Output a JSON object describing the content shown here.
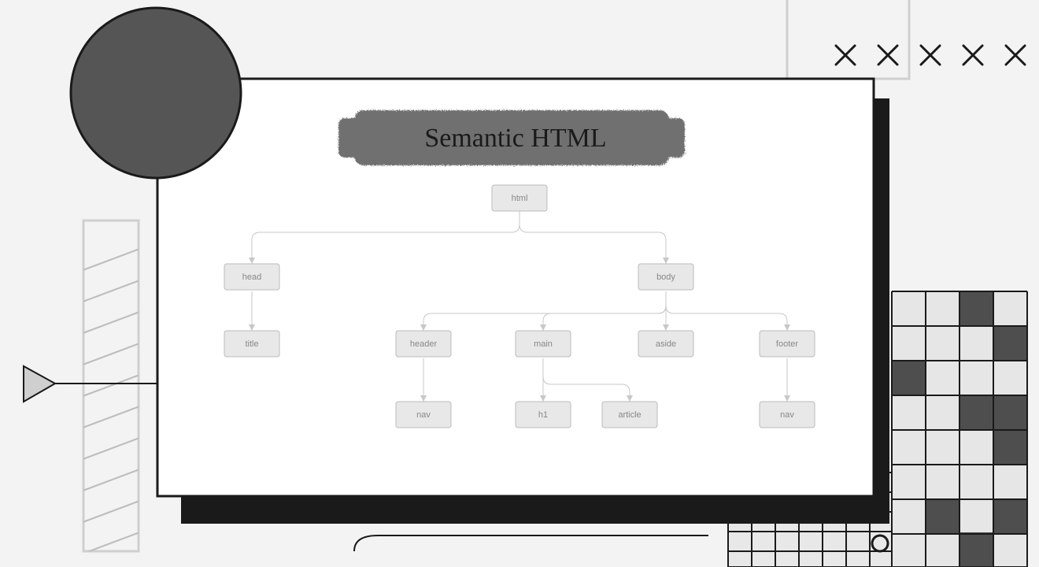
{
  "title": "Semantic HTML",
  "decor": {
    "x_symbol": "×"
  },
  "tree": {
    "root": {
      "label": "html"
    },
    "head": {
      "label": "head"
    },
    "title_n": {
      "label": "title"
    },
    "body": {
      "label": "body"
    },
    "header": {
      "label": "header"
    },
    "main": {
      "label": "main"
    },
    "aside": {
      "label": "aside"
    },
    "footer": {
      "label": "footer"
    },
    "nav1": {
      "label": "nav"
    },
    "h1": {
      "label": "h1"
    },
    "article": {
      "label": "article"
    },
    "nav2": {
      "label": "nav"
    }
  }
}
